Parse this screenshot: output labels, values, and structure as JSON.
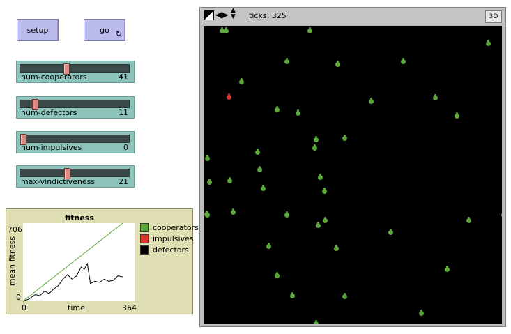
{
  "buttons": {
    "setup_label": "setup",
    "go_label": "go"
  },
  "sliders": [
    {
      "name": "num-cooperators",
      "value": "41",
      "level": 0.41
    },
    {
      "name": "num-defectors",
      "value": "11",
      "level": 0.11
    },
    {
      "name": "num-impulsives",
      "value": "0",
      "level": 0.0
    },
    {
      "name": "max-vindictiveness",
      "value": "21",
      "level": 0.42
    }
  ],
  "plot": {
    "title": "fitness",
    "ylabel": "mean fitness",
    "xlabel": "time",
    "ymax_label": "706",
    "ymin_label": "0",
    "xmin_label": "0",
    "xmax_label": "364",
    "legend": [
      {
        "name": "cooperators",
        "color": "#5ca63c"
      },
      {
        "name": "impulsives",
        "color": "#d6382e"
      },
      {
        "name": "defectors",
        "color": "#000000"
      }
    ]
  },
  "chart_data": {
    "type": "line",
    "title": "fitness",
    "xlabel": "time",
    "ylabel": "mean fitness",
    "xlim": [
      0,
      364
    ],
    "ylim": [
      0,
      706
    ],
    "series": [
      {
        "name": "cooperators",
        "color": "#5ca63c",
        "x": [
          0,
          325
        ],
        "y": [
          0,
          706
        ]
      },
      {
        "name": "defectors",
        "color": "#000000",
        "x": [
          0,
          20,
          40,
          55,
          70,
          85,
          100,
          115,
          130,
          145,
          160,
          175,
          190,
          200,
          210,
          220,
          235,
          250,
          265,
          280,
          295,
          310,
          325
        ],
        "y": [
          0,
          20,
          60,
          50,
          90,
          70,
          110,
          140,
          200,
          240,
          200,
          230,
          310,
          290,
          340,
          160,
          180,
          170,
          200,
          180,
          190,
          230,
          220
        ]
      }
    ]
  },
  "view": {
    "ticks_label": "ticks: 325",
    "btn3d_label": "3D",
    "turtle_colors": {
      "cooperator": "#5ca63c",
      "defector": "#d6382e"
    }
  }
}
